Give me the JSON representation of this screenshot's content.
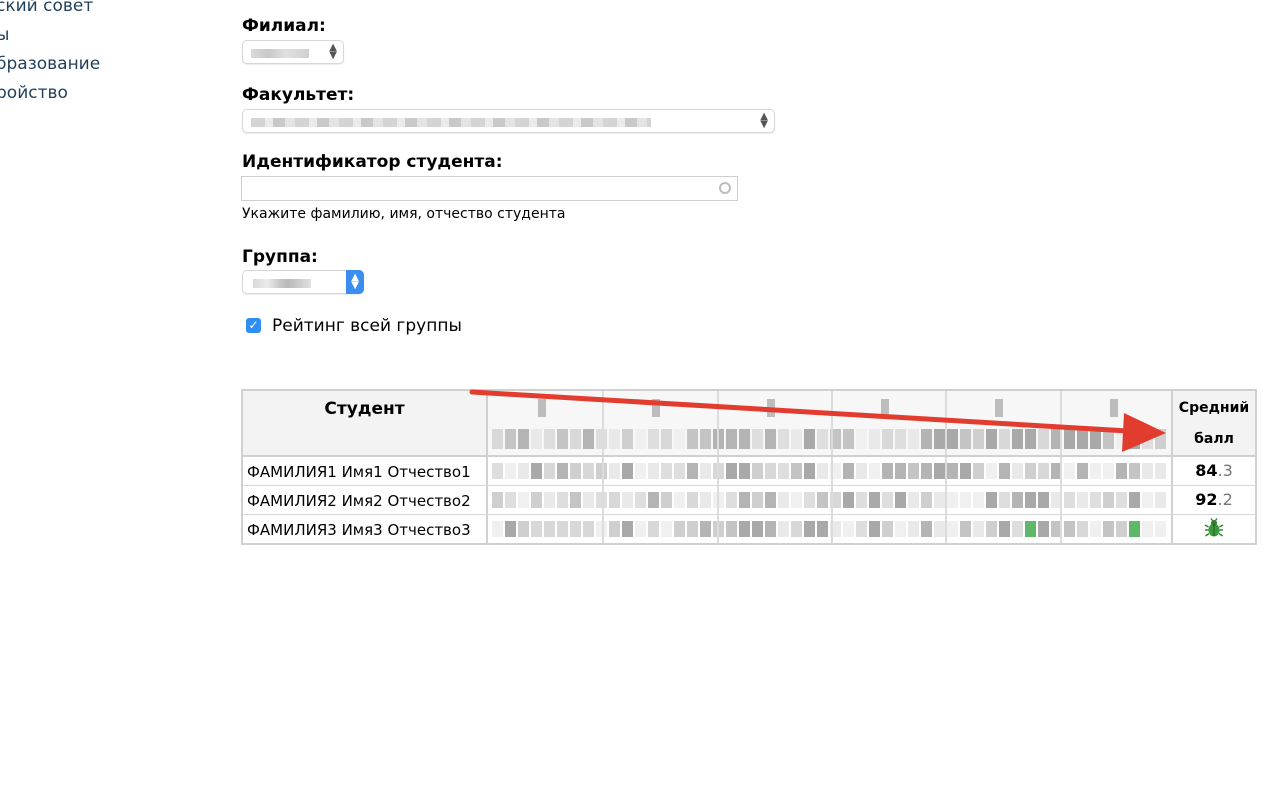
{
  "sidebar": {
    "items": [
      {
        "label": "ский совет"
      },
      {
        "label": "ы"
      },
      {
        "label": "бразование"
      },
      {
        "label": "ройство"
      }
    ]
  },
  "form": {
    "branch_label": "Филиал:",
    "faculty_label": "Факультет:",
    "student_id_label": "Идентификатор студента:",
    "student_id_value": "",
    "student_id_hint": "Укажите фамилию, имя, отчество студента",
    "group_label": "Группа:",
    "group_rating_label": "Рейтинг всей группы",
    "group_rating_checked": true
  },
  "table": {
    "col_student": "Студент",
    "col_average_line1": "Средний",
    "col_average_line2": "балл",
    "rows": [
      {
        "name": "ФАМИЛИЯ1 Имя1 Отчество1",
        "avg_int": "84",
        "avg_dec": ".3"
      },
      {
        "name": "ФАМИЛИЯ2 Имя2 Отчество2",
        "avg_int": "92",
        "avg_dec": ".2"
      },
      {
        "name": "ФАМИЛИЯ3 Имя3 Отчество3",
        "avg_icon": "bug-icon"
      }
    ]
  },
  "colors": {
    "arrow": "#e23c2f",
    "checkbox": "#2f8ef1",
    "link": "#1f3f5a",
    "bug": "#3a9a3a"
  }
}
